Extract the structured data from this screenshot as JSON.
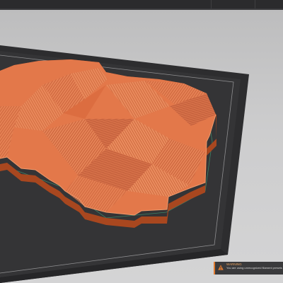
{
  "app": {
    "window_title": "",
    "tabs": [
      "",
      "",
      ""
    ]
  },
  "viewport": {
    "background_color": "#c9c9ca",
    "bed_color": "#323233",
    "model_color": "#e07038"
  },
  "notification": {
    "icon": "warning-icon",
    "title": "WARNING",
    "message": "You are using unrecognized filament presets"
  }
}
